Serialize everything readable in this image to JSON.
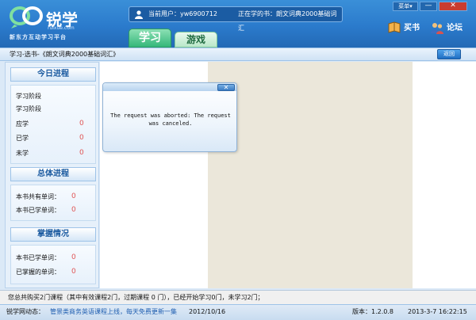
{
  "app": {
    "logo_text": "锐学",
    "logo_url": "ruixue.com",
    "slogan": "新东方互动学习平台"
  },
  "user_bar": {
    "current_user": "当前用户：yw6900712",
    "current_book": "正在学的书：朗文词典2000基础词汇"
  },
  "tabs": [
    {
      "label": "学习"
    },
    {
      "label": "游戏"
    }
  ],
  "window": {
    "menu_label": "菜单▾",
    "minimize": "—",
    "close": "✕"
  },
  "actions": {
    "buy": "买书",
    "forum": "论坛"
  },
  "crumb": "学习-选书-《朗文词典2000基础词汇》",
  "back_label": "返回",
  "sidebar": {
    "today": {
      "title": "今日进程",
      "stage1": "学习阶段",
      "stage2": "学习阶段",
      "due_label": "应学",
      "due_value": "0",
      "learned_label": "已学",
      "learned_value": "0",
      "unlearned_label": "未学",
      "unlearned_value": "0"
    },
    "overall": {
      "title": "总体进程",
      "total_label": "本书共有单词：",
      "total_value": "0",
      "learned_label": "本书已学单词：",
      "learned_value": "0"
    },
    "mastery": {
      "title": "掌握情况",
      "learned_label": "本书已学单词：",
      "learned_value": "0",
      "mastered_label": "已掌握的单词：",
      "mastered_value": "0"
    }
  },
  "dialog": {
    "close": "✕",
    "message": "The request was aborted: The request was canceled."
  },
  "status": "您总共购买2门课程（其中有效课程2门，过期课程 0 门），已经开始学习0门，未学习2门；",
  "footer": {
    "news_label": "锐学网动态：",
    "news_text": "管景类商务英语课程上线，每天免费更新一集",
    "news_date": "2012/10/16",
    "version": "版本：1.2.0.8",
    "datetime": "2013-3-7  16:22:15"
  },
  "colors": {
    "header_blue": "#2b7bcc",
    "tab_green": "#35b77a",
    "value_red": "#e05555",
    "news_blue": "#1f5eb0"
  }
}
